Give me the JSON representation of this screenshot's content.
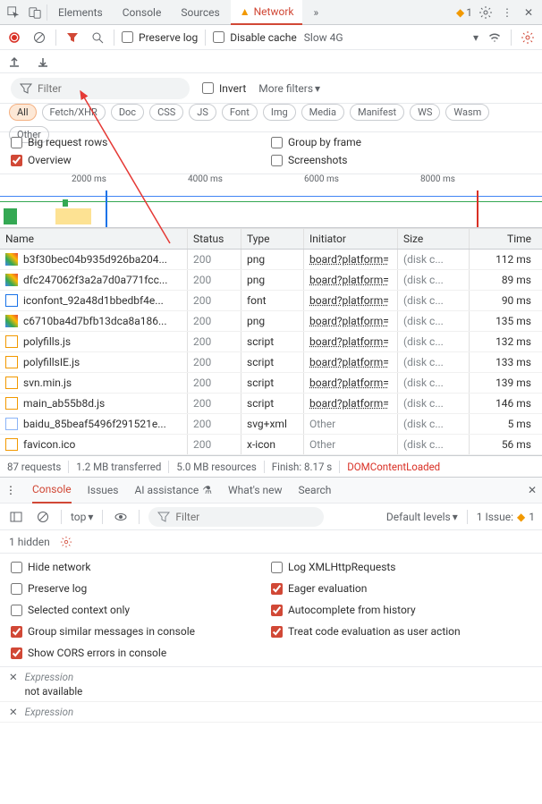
{
  "tabs": {
    "elements": "Elements",
    "console": "Console",
    "sources": "Sources",
    "network": "Network",
    "more": "»",
    "issues_count": "1"
  },
  "toolbar": {
    "preserve_log": "Preserve log",
    "disable_cache": "Disable cache",
    "throttling": "Slow 4G"
  },
  "filter": {
    "placeholder": "Filter",
    "invert": "Invert",
    "more_filters": "More filters"
  },
  "types": [
    "All",
    "Fetch/XHR",
    "Doc",
    "CSS",
    "JS",
    "Font",
    "Img",
    "Media",
    "Manifest",
    "WS",
    "Wasm",
    "Other"
  ],
  "options": {
    "big_rows": "Big request rows",
    "group_frame": "Group by frame",
    "overview": "Overview",
    "screenshots": "Screenshots"
  },
  "timeline_ticks": [
    "2000 ms",
    "4000 ms",
    "6000 ms",
    "8000 ms"
  ],
  "columns": [
    "Name",
    "Status",
    "Type",
    "Initiator",
    "Size",
    "Time"
  ],
  "rows": [
    {
      "icon": "img",
      "name": "b3f30bec04b935d926ba204...",
      "status": "200",
      "type": "png",
      "initiator": "board?platform=",
      "size": "(disk c...",
      "time": "112 ms"
    },
    {
      "icon": "img",
      "name": "dfc247062f3a2a7d0a771fcc...",
      "status": "200",
      "type": "png",
      "initiator": "board?platform=",
      "size": "(disk c...",
      "time": "89 ms"
    },
    {
      "icon": "font",
      "name": "iconfont_92a48d1bbedbf4e...",
      "status": "200",
      "type": "font",
      "initiator": "board?platform=",
      "size": "(disk c...",
      "time": "90 ms"
    },
    {
      "icon": "img",
      "name": "c6710ba4d7bfb13dca8a186...",
      "status": "200",
      "type": "png",
      "initiator": "board?platform=",
      "size": "(disk c...",
      "time": "135 ms"
    },
    {
      "icon": "js",
      "name": "polyfills.js",
      "status": "200",
      "type": "script",
      "initiator": "board?platform=",
      "size": "(disk c...",
      "time": "132 ms"
    },
    {
      "icon": "js",
      "name": "polyfillsIE.js",
      "status": "200",
      "type": "script",
      "initiator": "board?platform=",
      "size": "(disk c...",
      "time": "133 ms"
    },
    {
      "icon": "js",
      "name": "svn.min.js",
      "status": "200",
      "type": "script",
      "initiator": "board?platform=",
      "size": "(disk c...",
      "time": "139 ms"
    },
    {
      "icon": "js",
      "name": "main_ab55b8d.js",
      "status": "200",
      "type": "script",
      "initiator": "board?platform=",
      "size": "(disk c...",
      "time": "146 ms"
    },
    {
      "icon": "svg",
      "name": "baidu_85beaf5496f291521e...",
      "status": "200",
      "type": "svg+xml",
      "initiator": "Other",
      "initiator_dim": true,
      "size": "(disk c...",
      "time": "5 ms"
    },
    {
      "icon": "js",
      "name": "favicon.ico",
      "status": "200",
      "type": "x-icon",
      "initiator": "Other",
      "initiator_dim": true,
      "size": "(disk c...",
      "time": "56 ms"
    }
  ],
  "status": {
    "requests": "87 requests",
    "transferred": "1.2 MB transferred",
    "resources": "5.0 MB resources",
    "finish": "Finish: 8.17 s",
    "dcl": "DOMContentLoaded"
  },
  "console_tabs": {
    "console": "Console",
    "issues": "Issues",
    "ai": "AI assistance",
    "whatsnew": "What's new",
    "search": "Search"
  },
  "console_toolbar": {
    "context": "top",
    "filter_placeholder": "Filter",
    "levels": "Default levels",
    "issue_label": "1 Issue:",
    "issue_count": "1"
  },
  "hidden_label": "1 hidden",
  "console_opts": {
    "hide_network": "Hide network",
    "log_xhr": "Log XMLHttpRequests",
    "preserve_log": "Preserve log",
    "eager": "Eager evaluation",
    "selected_ctx": "Selected context only",
    "autocomplete": "Autocomplete from history",
    "group": "Group similar messages in console",
    "treat_eval": "Treat code evaluation as user action",
    "cors": "Show CORS errors in console"
  },
  "expr": {
    "label": "Expression",
    "na": "not available"
  }
}
